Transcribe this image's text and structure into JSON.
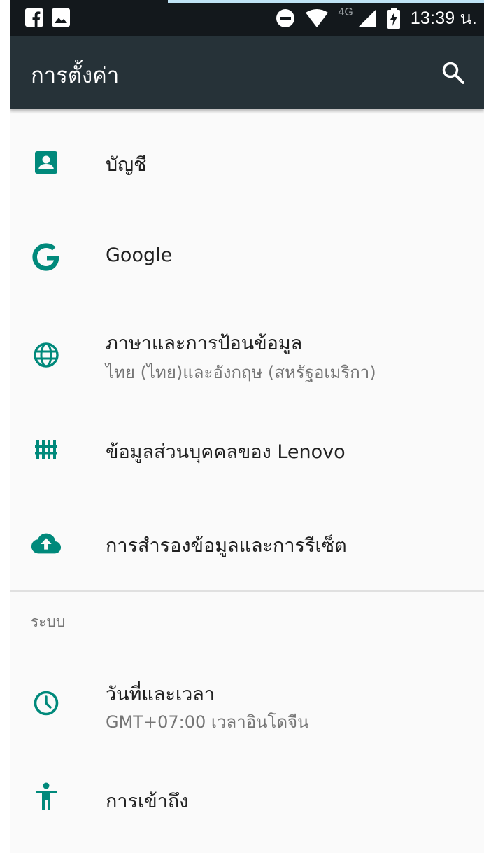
{
  "status_bar": {
    "time": "13:39 น.",
    "network": "4G",
    "notification_icons": [
      "facebook-icon",
      "image-icon"
    ],
    "system_icons": [
      "do-not-disturb-icon",
      "wifi-icon",
      "signal-icon",
      "battery-charging-icon"
    ]
  },
  "toolbar": {
    "title": "การตั้งค่า",
    "search_icon": "search-icon",
    "background": "#263238"
  },
  "accent_color": "#00897b",
  "items": [
    {
      "icon": "account-icon",
      "title": "บัญชี"
    },
    {
      "icon": "google-icon",
      "title": "Google"
    },
    {
      "icon": "globe-icon",
      "title": "ภาษาและการป้อนข้อมูล",
      "subtitle": "ไทย (ไทย)และอังกฤษ (สหรัฐอเมริกา)"
    },
    {
      "icon": "privacy-icon",
      "title": "ข้อมูลส่วนบุคคลของ Lenovo"
    },
    {
      "icon": "cloud-upload-icon",
      "title": "การสำรองข้อมูลและการรีเซ็ต"
    }
  ],
  "system_section": {
    "header": "ระบบ",
    "items": [
      {
        "icon": "clock-icon",
        "title": "วันที่และเวลา",
        "subtitle": "GMT+07:00 เวลาอินโดจีน"
      },
      {
        "icon": "accessibility-icon",
        "title": "การเข้าถึง"
      }
    ]
  }
}
